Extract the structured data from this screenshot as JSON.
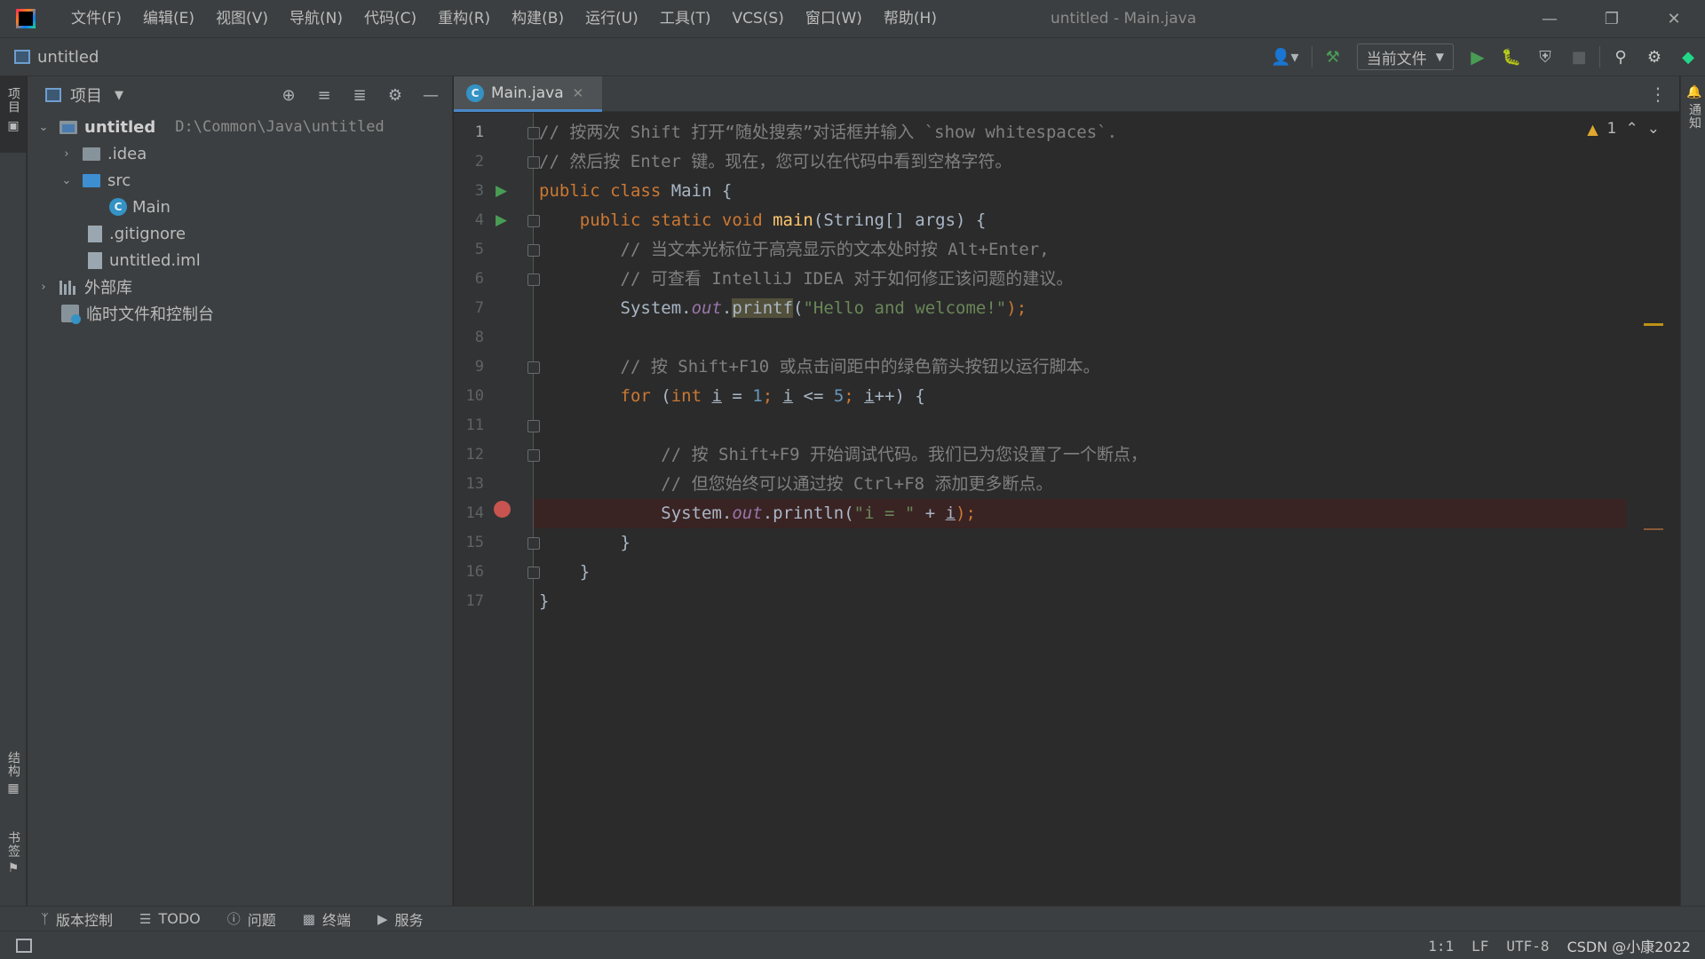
{
  "titlebar": {
    "menu": [
      "文件(F)",
      "编辑(E)",
      "视图(V)",
      "导航(N)",
      "代码(C)",
      "重构(R)",
      "构建(B)",
      "运行(U)",
      "工具(T)",
      "VCS(S)",
      "窗口(W)",
      "帮助(H)"
    ],
    "window_title": "untitled - Main.java"
  },
  "navbar": {
    "breadcrumb": "untitled",
    "run_config": "当前文件"
  },
  "left_stripe": {
    "project": "项目",
    "structure": "结构",
    "bookmarks": "书签"
  },
  "right_stripe": {
    "notifications": "通知"
  },
  "project_panel": {
    "title": "项目",
    "tree": [
      {
        "label": "untitled",
        "path": "D:\\Common\\Java\\untitled"
      },
      {
        "label": ".idea"
      },
      {
        "label": "src"
      },
      {
        "label": "Main"
      },
      {
        "label": ".gitignore"
      },
      {
        "label": "untitled.iml"
      },
      {
        "label": "外部库"
      },
      {
        "label": "临时文件和控制台"
      }
    ]
  },
  "editor": {
    "tab_label": "Main.java",
    "warning_count": "1",
    "line_numbers": [
      "1",
      "2",
      "3",
      "4",
      "5",
      "6",
      "7",
      "8",
      "9",
      "10",
      "11",
      "12",
      "13",
      "14",
      "15",
      "16",
      "17"
    ],
    "code": {
      "l1": "// 按两次 Shift 打开“随处搜索”对话框并输入 `show whitespaces`.",
      "l2": "// 然后按 Enter 键。现在，您可以在代码中看到空格字符。",
      "l3_kw": "public class ",
      "l3_name": "Main {",
      "l4_kw": "public static void ",
      "l4_fn": "main",
      "l4_rest": "(String[] args) {",
      "l5": "// 当文本光标位于高亮显示的文本处时按 Alt+Enter,",
      "l6": "// 可查看 IntelliJ IDEA 对于如何修正该问题的建议。",
      "l7_a": "System.",
      "l7_out": "out",
      "l7_dot": ".",
      "l7_fn": "printf",
      "l7_p": "(",
      "l7_str": "\"Hello and welcome!\"",
      "l7_end": ");",
      "l9": "// 按 Shift+F10 或点击间距中的绿色箭头按钮以运行脚本。",
      "l10_for": "for ",
      "l10_p1": "(",
      "l10_int": "int ",
      "l10_i1": "i",
      "l10_eq": " = ",
      "l10_one": "1",
      "l10_semi1": "; ",
      "l10_i2": "i",
      "l10_le": " <= ",
      "l10_five": "5",
      "l10_semi2": "; ",
      "l10_i3": "i",
      "l10_end": "++) {",
      "l12": "// 按 Shift+F9 开始调试代码。我们已为您设置了一个断点，",
      "l13": "// 但您始终可以通过按 Ctrl+F8 添加更多断点。",
      "l14_a": "System.",
      "l14_out": "out",
      "l14_b": ".println(",
      "l14_str": "\"i = \"",
      "l14_plus": " + ",
      "l14_i": "i",
      "l14_end": ");",
      "l15": "}",
      "l16": "}",
      "l17": "}"
    }
  },
  "bottom_bar": {
    "vcs": "版本控制",
    "todo": "TODO",
    "problems": "问题",
    "terminal": "终端",
    "services": "服务"
  },
  "status_bar": {
    "position": "1:1",
    "line_sep": "LF",
    "encoding": "UTF-8",
    "watermark": "CSDN @小康2022"
  },
  "colors": {
    "keyword": "#cc7832",
    "comment": "#808080",
    "string": "#6a8759",
    "number": "#6897bb",
    "function": "#ffc66d",
    "run_green": "#499c54",
    "breakpoint_red": "#c75450"
  }
}
